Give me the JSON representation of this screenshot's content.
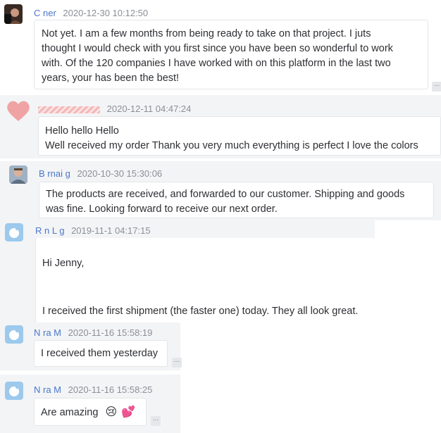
{
  "messages": [
    {
      "name": "C        ner",
      "time": "2020-12-30 10:12:50",
      "lines": [
        "Not yet. I am a few months from being ready to take on that project. I juts",
        "thought I would check with you first since you have been so wonderful to work",
        "with. Of the 120 companies I have worked with on this platform in the last two",
        "years, your has been the best!"
      ]
    },
    {
      "name": "",
      "time": "2020-12-11 04:47:24",
      "lines": [
        "Hello hello Hello",
        "Well received my order Thank you very much everything is perfect I love the colors"
      ]
    },
    {
      "name": "B  rnai    g",
      "time": "2020-10-30 15:30:06",
      "lines": [
        "The products are received, and forwarded to our customer. Shipping and goods",
        "was fine. Looking forward to receive our next order."
      ]
    },
    {
      "name": "R  n L  g",
      "time": "2019-11-1 04:17:15",
      "lines": [
        "Hi Jenny,",
        "",
        "I received the first shipment (the faster one) today. They all look great."
      ]
    },
    {
      "name": "N    ra M",
      "time": "2020-11-16 15:58:19",
      "lines": [
        "I received them yesterday"
      ]
    },
    {
      "name": "N    ra M",
      "time": "2020-11-16 15:58:25",
      "lines": [
        "Are amazing"
      ],
      "emoji": [
        "😢",
        "💕"
      ]
    }
  ],
  "more_label": "..."
}
